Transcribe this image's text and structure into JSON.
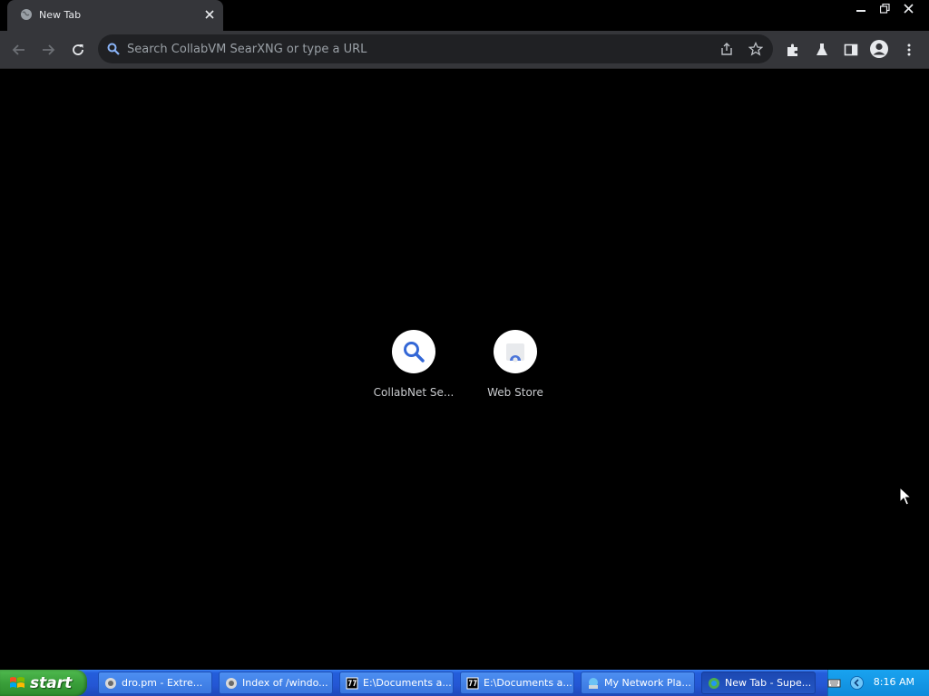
{
  "browser": {
    "tab": {
      "title": "New Tab"
    },
    "omnibox": {
      "placeholder": "Search CollabVM SearXNG or type a URL",
      "value": ""
    },
    "colors": {
      "accent": "#8ab4f8",
      "frame": "#000000",
      "toolbar": "#35363a"
    }
  },
  "ntp": {
    "shortcuts": [
      {
        "label": "CollabNet Se...",
        "icon": "magnifier-icon"
      },
      {
        "label": "Web Store",
        "icon": "web-store-icon"
      }
    ]
  },
  "taskbar": {
    "start_label": "start",
    "tasks": [
      {
        "label": "dro.pm - Extre...",
        "icon": "browser-icon",
        "active": false
      },
      {
        "label": "Index of /windo...",
        "icon": "browser-icon",
        "active": false
      },
      {
        "label": "E:\\Documents a...",
        "icon": "7zip-icon",
        "active": false
      },
      {
        "label": "E:\\Documents a...",
        "icon": "7zip-icon",
        "active": false
      },
      {
        "label": "My Network Pla...",
        "icon": "network-places-icon",
        "active": false
      },
      {
        "label": "New Tab - Supe...",
        "icon": "browser-icon",
        "active": true
      }
    ],
    "clock": "8:16 AM"
  }
}
